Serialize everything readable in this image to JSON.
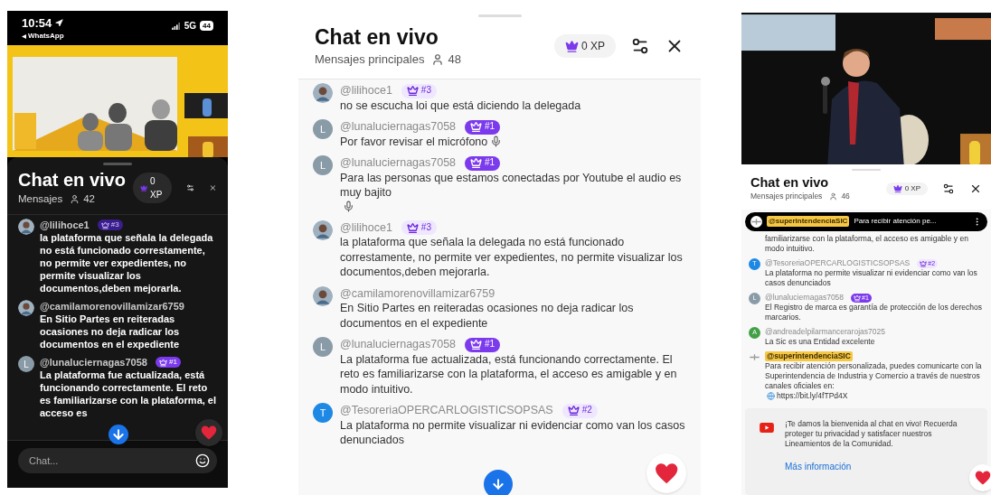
{
  "panels": [
    {
      "status_bar": {
        "time": "10:54",
        "back_app": "WhatsApp",
        "network": "5G",
        "battery": "44"
      },
      "chat": {
        "title": "Chat en vivo",
        "subtitle": "Mensajes",
        "xp": "0 XP",
        "viewers": "42"
      },
      "messages": [
        {
          "kind": "message",
          "author": "@lilihoce1",
          "badge": {
            "rank": "#3",
            "featured": false
          },
          "text": "la plataforma que señala la delegada no está funcionado correstamente, no permite ver expedientes, no permite visualizar los documentos,deben mejorarla."
        },
        {
          "kind": "message",
          "author": "@camilamorenovillamizar6759",
          "text": "En Sitio Partes en reiteradas ocasiones no deja radicar los documentos en el expediente"
        },
        {
          "kind": "message",
          "author": "@lunaluciernagas7058",
          "avatar": {
            "kind": "letter",
            "letter": "L",
            "color": "#8a9ba8"
          },
          "badge": {
            "rank": "#1",
            "featured": true
          },
          "text": "La plataforma fue actualizada, está funcionando correctamente. El reto es familiarizarse con la plataforma, el acceso es"
        }
      ],
      "input": {
        "placeholder": "Chat..."
      }
    },
    {
      "chat": {
        "title": "Chat en vivo",
        "subtitle": "Mensajes principales",
        "xp": "0 XP",
        "viewers": "48"
      },
      "messages": [
        {
          "kind": "message",
          "author": "@lilihoce1",
          "badge": {
            "rank": "#3",
            "featured": false
          },
          "text": "no se escucha loi que está diciendo la delegada"
        },
        {
          "kind": "mic",
          "author": "@lunaluciernagas7058",
          "avatar": {
            "kind": "letter",
            "letter": "L",
            "color": "#8a9ba8"
          },
          "badge": {
            "rank": "#1",
            "featured": true
          },
          "text": "Por favor revisar el micrófono"
        },
        {
          "kind": "mic",
          "author": "@lunaluciernagas7058",
          "avatar": {
            "kind": "letter",
            "letter": "L",
            "color": "#8a9ba8"
          },
          "badge": {
            "rank": "#1",
            "featured": true
          },
          "text": "Para las personas que estamos conectadas por Youtube el audio es muy bajito"
        },
        {
          "kind": "message",
          "author": "@lilihoce1",
          "badge": {
            "rank": "#3",
            "featured": false
          },
          "text": "la plataforma que señala la delegada no está funcionado correstamente, no permite ver expedientes, no permite visualizar los documentos,deben mejorarla."
        },
        {
          "kind": "message",
          "author": "@camilamorenovillamizar6759",
          "text": "En Sitio Partes en reiteradas ocasiones no deja radicar los documentos en el expediente"
        },
        {
          "kind": "message",
          "author": "@lunaluciernagas7058",
          "avatar": {
            "kind": "letter",
            "letter": "L",
            "color": "#8a9ba8"
          },
          "badge": {
            "rank": "#1",
            "featured": true
          },
          "text": "La plataforma fue actualizada, está funcionando correctamente. El reto es familiarizarse con la plataforma, el acceso es amigable y en modo intuitivo."
        },
        {
          "kind": "message",
          "author": "@TesoreriaOPERCARLOGISTICSOPSAS",
          "avatar": {
            "kind": "letter",
            "letter": "T",
            "color": "#1e88e5"
          },
          "badge": {
            "rank": "#2",
            "featured": false
          },
          "text": "La plataforma no permite visualizar ni evidenciar como van los casos denunciados"
        }
      ]
    },
    {
      "chat": {
        "title": "Chat en vivo",
        "subtitle": "Mensajes principales",
        "xp": "0 XP",
        "viewers": "46"
      },
      "pinned": {
        "author": "@superintendenciaSIC",
        "text": "Para recibir atención pe..."
      },
      "messages": [
        {
          "kind": "continuation",
          "text": "familiarizarse con la plataforma, el acceso es amigable y en modo intuitivo."
        },
        {
          "kind": "message",
          "author": "@TesoreriaOPERCARLOGISTICSOPSAS",
          "avatar": {
            "kind": "letter",
            "letter": "T",
            "color": "#1e88e5"
          },
          "badge": {
            "rank": "#2",
            "featured": false
          },
          "text": "La plataforma no permite visualizar ni evidenciar como van los casos denunciados"
        },
        {
          "kind": "message",
          "author": "@lunaluciernagas7058",
          "avatar": {
            "kind": "letter",
            "letter": "L",
            "color": "#8a9ba8"
          },
          "badge": {
            "rank": "#1",
            "featured": true
          },
          "text": "El Registro de marca es garantía de protección de los derechos marcarios."
        },
        {
          "kind": "message",
          "author": "@andreadelpilarmancerarojas7025",
          "avatar": {
            "kind": "letter",
            "letter": "A",
            "color": "#43a047"
          },
          "text": "La Sic es una Entidad excelente"
        },
        {
          "kind": "owner",
          "author": "@superintendenciaSIC",
          "avatar": {
            "kind": "logo"
          },
          "text": "Para recibir atención personalizada, puedes comunicarte con la Superintendencia de Industria y Comercio a través de nuestros canales oficiales en:",
          "link": "https://bit.ly/4fTPd4X"
        }
      ],
      "welcome": {
        "text": "¡Te damos la bienvenida al chat en vivo! Recuerda proteger tu privacidad y satisfacer nuestros Lineamientos de la Comunidad.",
        "link": "Más información"
      }
    }
  ]
}
